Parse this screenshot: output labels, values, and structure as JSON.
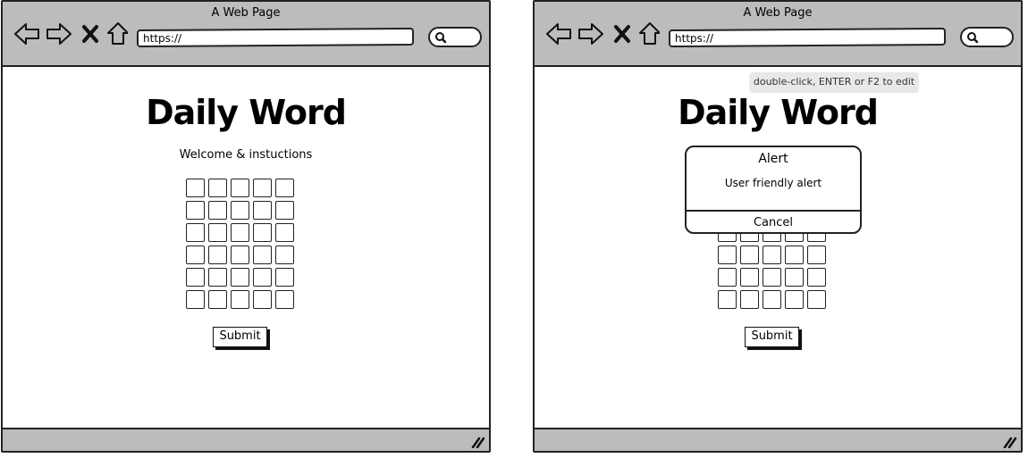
{
  "windows": [
    {
      "id": "left",
      "title": "A Web Page",
      "url": "https://",
      "heading": "Daily Word",
      "welcome": "Welcome & instuctions",
      "grid": {
        "rows": 6,
        "cols": 5
      },
      "submit_label": "Submit"
    },
    {
      "id": "right",
      "title": "A Web Page",
      "url": "https://",
      "heading": "Daily Word",
      "tooltip": "double-click, ENTER or F2 to edit",
      "alert": {
        "title": "Alert",
        "message": "User friendly alert",
        "cancel_label": "Cancel"
      },
      "grid": {
        "rows": 6,
        "cols": 5
      },
      "submit_label": "Submit"
    }
  ]
}
